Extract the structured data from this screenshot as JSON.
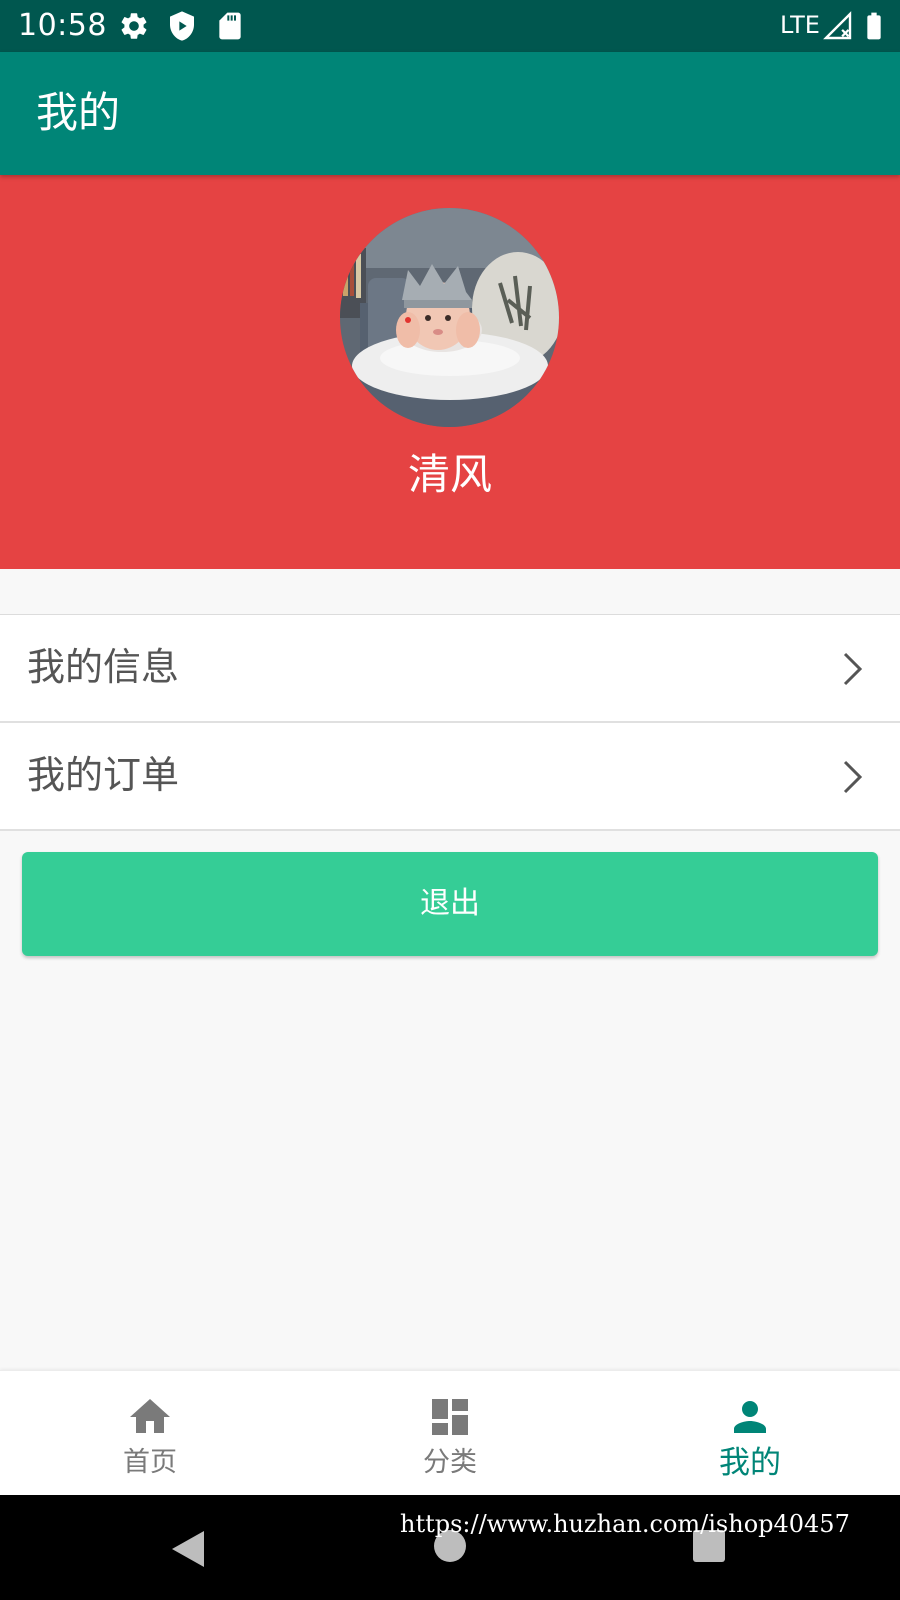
{
  "status_bar": {
    "time": "10:58",
    "network": "LTE",
    "icons": [
      "settings-icon",
      "shield-icon",
      "sd-card-icon",
      "signal-icon",
      "battery-icon"
    ]
  },
  "app_bar": {
    "title": "我的"
  },
  "profile": {
    "username": "清风",
    "background_color": "#e54343"
  },
  "menu": {
    "items": [
      {
        "label": "我的信息",
        "icon": "chevron-right-icon"
      },
      {
        "label": "我的订单",
        "icon": "chevron-right-icon"
      }
    ]
  },
  "logout": {
    "label": "退出",
    "color": "#35cd96"
  },
  "bottom_nav": {
    "items": [
      {
        "label": "首页",
        "icon": "home-icon",
        "active": false
      },
      {
        "label": "分类",
        "icon": "dashboard-icon",
        "active": false
      },
      {
        "label": "我的",
        "icon": "person-icon",
        "active": true
      }
    ],
    "active_color": "#008577",
    "inactive_color": "#7a7a7a"
  },
  "system_nav": {
    "icons": [
      "back-icon",
      "home-circle-icon",
      "recents-icon"
    ]
  },
  "watermark": "https://www.huzhan.com/ishop40457",
  "theme": {
    "primary": "#008577",
    "primary_dark": "#00574f"
  }
}
